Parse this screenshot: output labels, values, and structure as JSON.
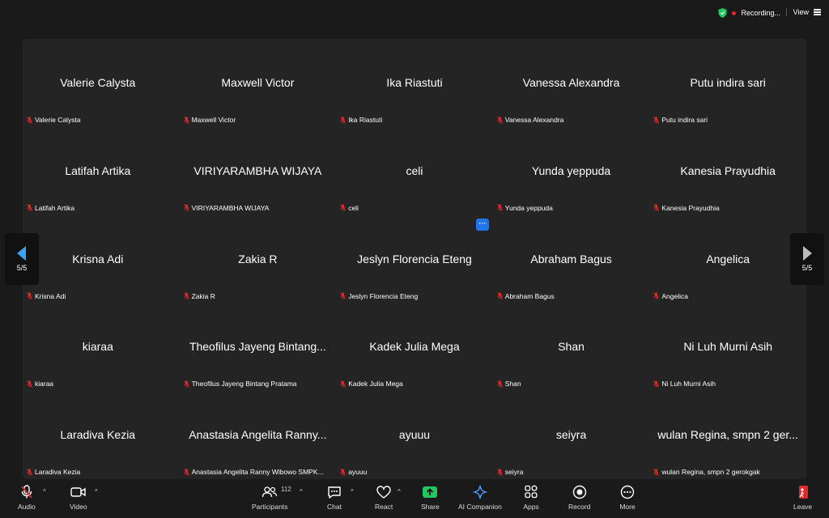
{
  "topbar": {
    "recording_label": "Recording...",
    "view_label": "View"
  },
  "gallery": {
    "page_indicator": "5/5",
    "participants": [
      {
        "display": "Valerie Calysta",
        "label": "Valerie Calysta"
      },
      {
        "display": "Maxwell Victor",
        "label": "Maxwell Victor"
      },
      {
        "display": "Ika Riastuti",
        "label": "Ika Riastuti"
      },
      {
        "display": "Vanessa Alexandra",
        "label": "Vanessa Alexandra"
      },
      {
        "display": "Putu indira sari",
        "label": "Putu indira sari"
      },
      {
        "display": "Latifah Artika",
        "label": "Latifah Artika"
      },
      {
        "display": "VIRIYARAMBHA WIJAYA",
        "label": "VIRIYARAMBHA WIJAYA"
      },
      {
        "display": "celi",
        "label": "celi"
      },
      {
        "display": "Yunda yeppuda",
        "label": "Yunda yeppuda"
      },
      {
        "display": "Kanesia Prayudhia",
        "label": "Kanesia Prayudhia"
      },
      {
        "display": "Krisna Adi",
        "label": "Krisna Adi"
      },
      {
        "display": "Zakia R",
        "label": "Zakia R"
      },
      {
        "display": "Jeslyn Florencia Eteng",
        "label": "Jeslyn Florencia Eteng"
      },
      {
        "display": "Abraham Bagus",
        "label": "Abraham Bagus"
      },
      {
        "display": "Angelica",
        "label": "Angelica"
      },
      {
        "display": "kiaraa",
        "label": "kiaraa"
      },
      {
        "display": "Theofilus Jayeng Bintang...",
        "label": "Theofilus Jayeng Bintang Pratama"
      },
      {
        "display": "Kadek Julia Mega",
        "label": "Kadek Julia Mega"
      },
      {
        "display": "Shan",
        "label": "Shan"
      },
      {
        "display": "Ni Luh Murni Asih",
        "label": "Ni Luh Murni Asih"
      },
      {
        "display": "Laradiva Kezia",
        "label": "Laradiva Kezia"
      },
      {
        "display": "Anastasia Angelita Ranny...",
        "label": "Anastasia Angelita Ranny Wibowo SMPK..."
      },
      {
        "display": "ayuuu",
        "label": "ayuuu"
      },
      {
        "display": "seiyra",
        "label": "seiyra"
      },
      {
        "display": "wulan Regina, smpn 2 ger...",
        "label": "wulan Regina, smpn 2 gerokgak"
      }
    ]
  },
  "toolbar": {
    "audio": "Audio",
    "video": "Video",
    "participants": "Participants",
    "participants_count": "112",
    "chat": "Chat",
    "react": "React",
    "share": "Share",
    "ai_companion": "AI Companion",
    "apps": "Apps",
    "record": "Record",
    "more": "More",
    "leave": "Leave"
  },
  "colors": {
    "accent_blue": "#1e74e8",
    "share_green": "#22c55e",
    "muted_red": "#e02828",
    "leave_red": "#e02828"
  }
}
